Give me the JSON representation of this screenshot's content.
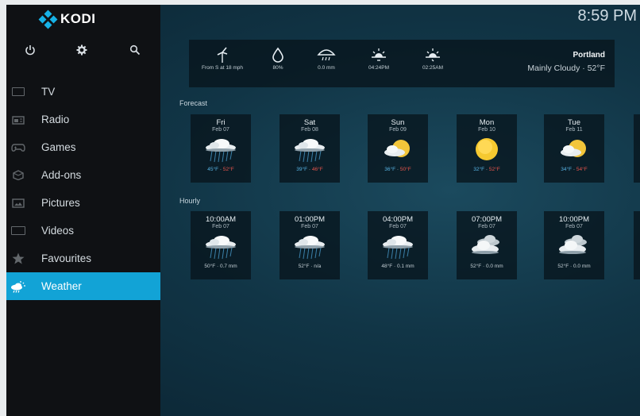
{
  "app": {
    "logo_text": "KODI",
    "clock": "8:59 PM",
    "accent_color": "#12a3d6"
  },
  "top_icons": [
    {
      "name": "power-icon"
    },
    {
      "name": "gear-icon"
    },
    {
      "name": "search-icon"
    }
  ],
  "sidebar": {
    "items": [
      {
        "label": "TV",
        "icon": "tv-icon"
      },
      {
        "label": "Radio",
        "icon": "radio-icon"
      },
      {
        "label": "Games",
        "icon": "gamepad-icon"
      },
      {
        "label": "Add-ons",
        "icon": "addons-icon"
      },
      {
        "label": "Pictures",
        "icon": "pictures-icon"
      },
      {
        "label": "Videos",
        "icon": "videos-icon"
      },
      {
        "label": "Favourites",
        "icon": "star-icon"
      },
      {
        "label": "Weather",
        "icon": "weather-icon",
        "active": true
      }
    ]
  },
  "current": {
    "wind": "From S at 18 mph",
    "humidity": "80%",
    "precipitation": "0.0 mm",
    "sunrise": "04:24PM",
    "sunset": "02:25AM",
    "city": "Portland",
    "condition": "Mainly Cloudy · 52°F"
  },
  "sections": {
    "forecast_label": "Forecast",
    "hourly_label": "Hourly"
  },
  "forecast": [
    {
      "day": "Fri",
      "date": "Feb 07",
      "low": "45°F",
      "high": "52°F",
      "icon": "rain-cloud-icon"
    },
    {
      "day": "Sat",
      "date": "Feb 08",
      "low": "39°F",
      "high": "46°F",
      "icon": "rain-cloud-icon"
    },
    {
      "day": "Sun",
      "date": "Feb 09",
      "low": "36°F",
      "high": "50°F",
      "icon": "partly-sunny-icon"
    },
    {
      "day": "Mon",
      "date": "Feb 10",
      "low": "32°F",
      "high": "52°F",
      "icon": "sun-icon"
    },
    {
      "day": "Tue",
      "date": "Feb 11",
      "low": "34°F",
      "high": "54°F",
      "icon": "partly-sunny-icon"
    }
  ],
  "hourly": [
    {
      "time": "10:00AM",
      "date": "Feb 07",
      "detail": "50°F · 0.7 mm",
      "icon": "rain-cloud-icon"
    },
    {
      "time": "01:00PM",
      "date": "Feb 07",
      "detail": "52°F · n/a",
      "icon": "rain-cloud-icon"
    },
    {
      "time": "04:00PM",
      "date": "Feb 07",
      "detail": "48°F · 0.1 mm",
      "icon": "rain-cloud-icon"
    },
    {
      "time": "07:00PM",
      "date": "Feb 07",
      "detail": "52°F · 0.0 mm",
      "icon": "cloudy-icon"
    },
    {
      "time": "10:00PM",
      "date": "Feb 07",
      "detail": "52°F · 0.0 mm",
      "icon": "cloudy-icon"
    }
  ]
}
